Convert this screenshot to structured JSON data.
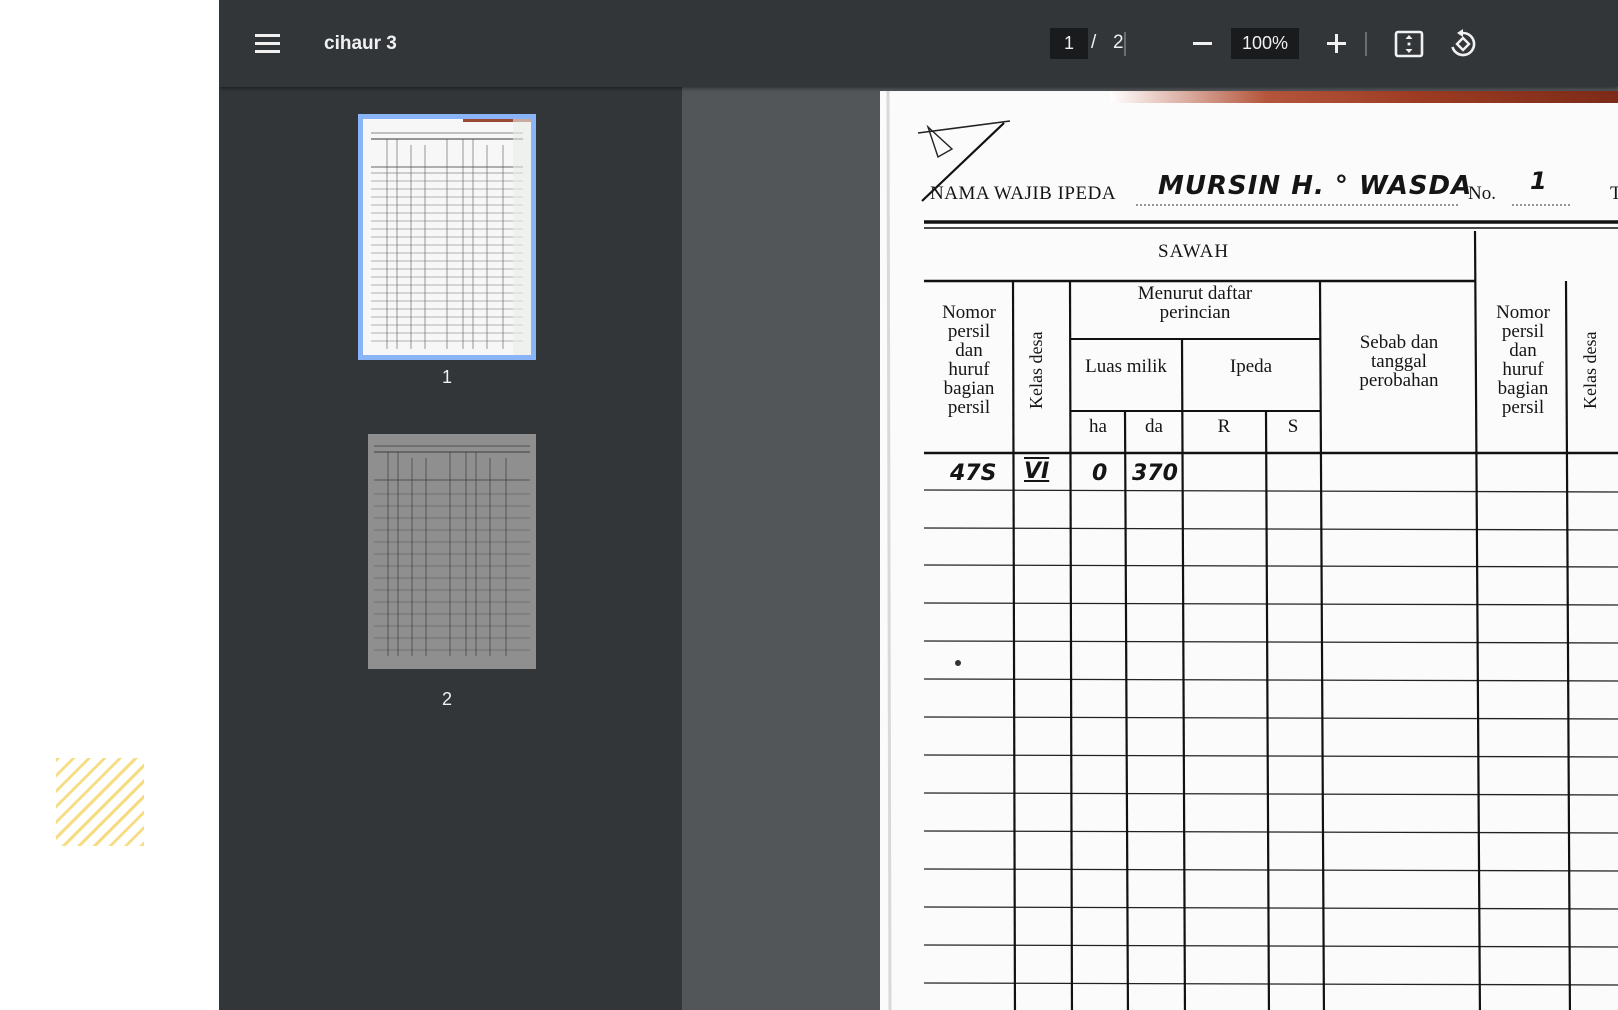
{
  "toolbar": {
    "title": "cihaur 3",
    "current_page": "1",
    "separator": "/",
    "total_pages": "2",
    "zoom": "100%",
    "icons": [
      "menu-icon",
      "zoom-out-icon",
      "zoom-in-icon",
      "fit-to-page-icon",
      "rotate-icon"
    ]
  },
  "sidebar": {
    "thumbnails": [
      {
        "label": "1",
        "selected": true
      },
      {
        "label": "2",
        "selected": false
      }
    ]
  },
  "document": {
    "name_label": "NAMA WAJIB IPEDA",
    "name_value": "MURSIN H. ° WASDA",
    "no_label": "No.",
    "no_value": "1",
    "right_cut": "Tl",
    "section": "SAWAH",
    "headers": {
      "nomor_persil": [
        "Nomor",
        "persil",
        "dan",
        "huruf",
        "bagian",
        "persil"
      ],
      "kelas_desa": "Kelas desa",
      "menurut": [
        "Menurut daftar",
        "perincian"
      ],
      "luas_milik": "Luas  milik",
      "ipeda": "Ipeda",
      "ha": "ha",
      "da": "da",
      "r": "R",
      "s": "S",
      "sebab": [
        "Sebab dan",
        "tanggal",
        "perobahan"
      ],
      "nomor_persil_2": [
        "Nomor",
        "persil",
        "dan",
        "huruf",
        "bagian",
        "persil"
      ],
      "kelas_desa_2": "Kelas desa"
    },
    "row1": {
      "persil": "47S",
      "kelas": "VI",
      "ha": "0",
      "da": "370"
    }
  },
  "colors": {
    "toolbar_bg": "#323639",
    "viewer_bg": "#525659",
    "selected_thumb_border": "#8ab4f8",
    "decor_stripes": "#f6dd83"
  }
}
